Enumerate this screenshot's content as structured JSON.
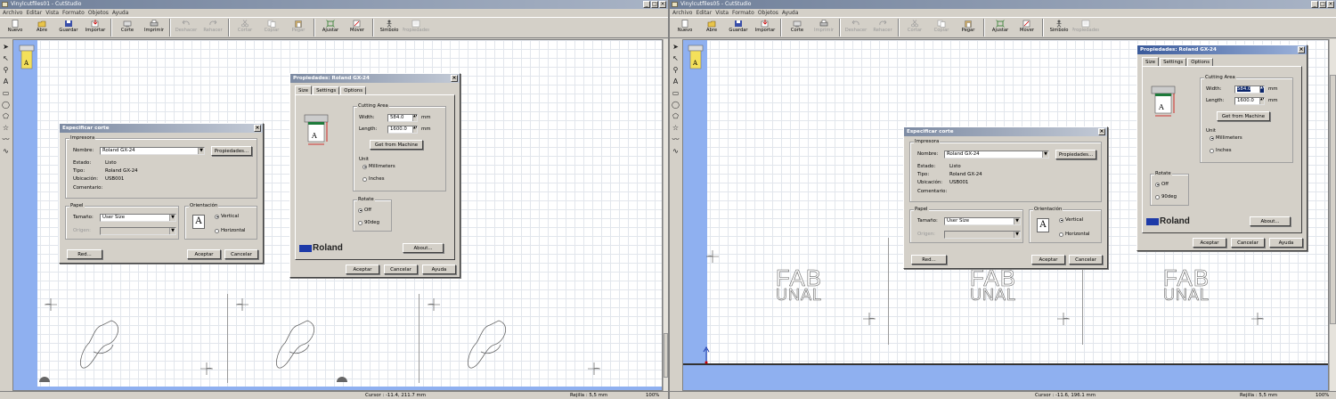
{
  "left": {
    "title": "Vinylcutfiles01 - CutStudio",
    "menu": [
      "Archivo",
      "Editar",
      "Vista",
      "Formato",
      "Objetos",
      "Ayuda"
    ],
    "toolbar": [
      {
        "label": "Nuevo",
        "icon": "new-doc-icon",
        "enabled": true
      },
      {
        "label": "Abre",
        "icon": "open-folder-icon",
        "enabled": true
      },
      {
        "label": "Guardar",
        "icon": "save-disk-icon",
        "enabled": true
      },
      {
        "label": "Importar",
        "icon": "import-icon",
        "enabled": true
      },
      {
        "label": "Corte",
        "icon": "cut-icon",
        "enabled": true
      },
      {
        "label": "Imprimir",
        "icon": "printer-icon",
        "enabled": true
      },
      {
        "label": "Deshacer",
        "icon": "undo-icon",
        "enabled": false
      },
      {
        "label": "Rehacer",
        "icon": "redo-icon",
        "enabled": false
      },
      {
        "label": "Cortar",
        "icon": "scissors-icon",
        "enabled": false
      },
      {
        "label": "Copiar",
        "icon": "copy-icon",
        "enabled": false
      },
      {
        "label": "Pegar",
        "icon": "paste-icon",
        "enabled": false
      },
      {
        "label": "Ajustar",
        "icon": "fit-icon",
        "enabled": true
      },
      {
        "label": "Mover",
        "icon": "move-icon",
        "enabled": true
      },
      {
        "label": "Simbolo",
        "icon": "symbol-icon",
        "enabled": true
      },
      {
        "label": "Propiedades",
        "icon": "properties-icon",
        "enabled": false
      }
    ],
    "status": {
      "cursor": "Cursor : -11.4, 211.7 mm",
      "grid": "Rejilla : 5,5 mm",
      "zoom": "100%"
    },
    "spec": {
      "title": "Especificar corte",
      "impresora": "Impresora",
      "nombre_label": "Nombre:",
      "nombre": "Roland GX-24",
      "propiedades": "Propiedades...",
      "estado_label": "Estado:",
      "estado": "Listo",
      "tipo_label": "Tipo:",
      "tipo": "Roland GX-24",
      "ubicacion_label": "Ubicación:",
      "ubicacion": "USB001",
      "comentario_label": "Comentario:",
      "papel": "Papel",
      "tamano_label": "Tamaño:",
      "tamano": "User Size",
      "origen_label": "Origen:",
      "orientacion": "Orientación",
      "vertical": "Vertical",
      "horizontal": "Horizontal",
      "red": "Red...",
      "aceptar": "Aceptar",
      "cancelar": "Cancelar"
    },
    "props": {
      "title": "Propiedades: Roland GX-24",
      "tabs": [
        "Size",
        "Settings",
        "Options"
      ],
      "cutting_area": "Cutting Area",
      "width_label": "Width:",
      "width": "584.0",
      "length_label": "Length:",
      "length": "1600.0",
      "unit_mm": "mm",
      "get_machine": "Get from Machine",
      "unit": "Unit",
      "millimeters": "Millimeters",
      "inches": "Inches",
      "rotate": "Rotate",
      "off": "Off",
      "deg90": "90deg",
      "brand": "Roland",
      "about": "About...",
      "aceptar": "Aceptar",
      "cancelar": "Cancelar",
      "ayuda": "Ayuda"
    }
  },
  "right": {
    "title": "Vinylcutfiles05 - CutStudio",
    "menu": [
      "Archivo",
      "Editar",
      "Vista",
      "Formato",
      "Objetos",
      "Ayuda"
    ],
    "toolbar": [
      {
        "label": "Nuevo",
        "icon": "new-doc-icon",
        "enabled": true
      },
      {
        "label": "Abre",
        "icon": "open-folder-icon",
        "enabled": true
      },
      {
        "label": "Guardar",
        "icon": "save-disk-icon",
        "enabled": true
      },
      {
        "label": "Importar",
        "icon": "import-icon",
        "enabled": true
      },
      {
        "label": "Corte",
        "icon": "cut-icon",
        "enabled": true
      },
      {
        "label": "Imprimir",
        "icon": "printer-icon",
        "enabled": false
      },
      {
        "label": "Deshacer",
        "icon": "undo-icon",
        "enabled": false
      },
      {
        "label": "Rehacer",
        "icon": "redo-icon",
        "enabled": false
      },
      {
        "label": "Cortar",
        "icon": "scissors-icon",
        "enabled": false
      },
      {
        "label": "Copiar",
        "icon": "copy-icon",
        "enabled": false
      },
      {
        "label": "Pegar",
        "icon": "paste-icon",
        "enabled": true
      },
      {
        "label": "Ajustar",
        "icon": "fit-icon",
        "enabled": true
      },
      {
        "label": "Mover",
        "icon": "move-icon",
        "enabled": true
      },
      {
        "label": "Simbolo",
        "icon": "symbol-icon",
        "enabled": true
      },
      {
        "label": "Propiedades",
        "icon": "properties-icon",
        "enabled": false
      }
    ],
    "status": {
      "cursor": "Cursor : -11.6, 196.1 mm",
      "grid": "Rejilla : 5,5 mm",
      "zoom": "100%"
    },
    "fab_text": "FAB",
    "unal_text": "UNAL",
    "spec": {
      "title": "Especificar corte",
      "impresora": "Impresora",
      "nombre_label": "Nombre:",
      "nombre": "Roland GX-24",
      "propiedades": "Propiedades...",
      "estado_label": "Estado:",
      "estado": "Listo",
      "tipo_label": "Tipo:",
      "tipo": "Roland GX-24",
      "ubicacion_label": "Ubicación:",
      "ubicacion": "USB001",
      "comentario_label": "Comentario:",
      "papel": "Papel",
      "tamano_label": "Tamaño:",
      "tamano": "User Size",
      "origen_label": "Origen:",
      "orientacion": "Orientación",
      "vertical": "Vertical",
      "horizontal": "Horizontal",
      "red": "Red...",
      "aceptar": "Aceptar",
      "cancelar": "Cancelar"
    },
    "props": {
      "title": "Propiedades: Roland GX-24",
      "tabs": [
        "Size",
        "Settings",
        "Options"
      ],
      "cutting_area": "Cutting Area",
      "width_label": "Width:",
      "width": "584.0",
      "length_label": "Length:",
      "length": "1600.0",
      "unit_mm": "mm",
      "get_machine": "Get from Machine",
      "unit": "Unit",
      "millimeters": "Millimeters",
      "inches": "Inches",
      "rotate": "Rotate",
      "off": "Off",
      "deg90": "90deg",
      "brand": "Roland",
      "about": "About...",
      "aceptar": "Aceptar",
      "cancelar": "Cancelar",
      "ayuda": "Ayuda"
    }
  },
  "colors": {
    "canvas_blue": "#8fb0f0",
    "title_active": "#3a5a9a",
    "roland_blue": "#1d3aa8"
  }
}
